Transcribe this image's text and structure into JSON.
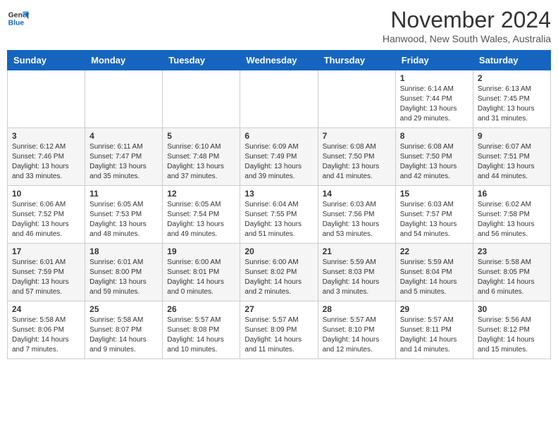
{
  "header": {
    "logo_line1": "General",
    "logo_line2": "Blue",
    "month_title": "November 2024",
    "location": "Hanwood, New South Wales, Australia"
  },
  "weekdays": [
    "Sunday",
    "Monday",
    "Tuesday",
    "Wednesday",
    "Thursday",
    "Friday",
    "Saturday"
  ],
  "weeks": [
    [
      {
        "day": "",
        "text": ""
      },
      {
        "day": "",
        "text": ""
      },
      {
        "day": "",
        "text": ""
      },
      {
        "day": "",
        "text": ""
      },
      {
        "day": "",
        "text": ""
      },
      {
        "day": "1",
        "text": "Sunrise: 6:14 AM\nSunset: 7:44 PM\nDaylight: 13 hours\nand 29 minutes."
      },
      {
        "day": "2",
        "text": "Sunrise: 6:13 AM\nSunset: 7:45 PM\nDaylight: 13 hours\nand 31 minutes."
      }
    ],
    [
      {
        "day": "3",
        "text": "Sunrise: 6:12 AM\nSunset: 7:46 PM\nDaylight: 13 hours\nand 33 minutes."
      },
      {
        "day": "4",
        "text": "Sunrise: 6:11 AM\nSunset: 7:47 PM\nDaylight: 13 hours\nand 35 minutes."
      },
      {
        "day": "5",
        "text": "Sunrise: 6:10 AM\nSunset: 7:48 PM\nDaylight: 13 hours\nand 37 minutes."
      },
      {
        "day": "6",
        "text": "Sunrise: 6:09 AM\nSunset: 7:49 PM\nDaylight: 13 hours\nand 39 minutes."
      },
      {
        "day": "7",
        "text": "Sunrise: 6:08 AM\nSunset: 7:50 PM\nDaylight: 13 hours\nand 41 minutes."
      },
      {
        "day": "8",
        "text": "Sunrise: 6:08 AM\nSunset: 7:50 PM\nDaylight: 13 hours\nand 42 minutes."
      },
      {
        "day": "9",
        "text": "Sunrise: 6:07 AM\nSunset: 7:51 PM\nDaylight: 13 hours\nand 44 minutes."
      }
    ],
    [
      {
        "day": "10",
        "text": "Sunrise: 6:06 AM\nSunset: 7:52 PM\nDaylight: 13 hours\nand 46 minutes."
      },
      {
        "day": "11",
        "text": "Sunrise: 6:05 AM\nSunset: 7:53 PM\nDaylight: 13 hours\nand 48 minutes."
      },
      {
        "day": "12",
        "text": "Sunrise: 6:05 AM\nSunset: 7:54 PM\nDaylight: 13 hours\nand 49 minutes."
      },
      {
        "day": "13",
        "text": "Sunrise: 6:04 AM\nSunset: 7:55 PM\nDaylight: 13 hours\nand 51 minutes."
      },
      {
        "day": "14",
        "text": "Sunrise: 6:03 AM\nSunset: 7:56 PM\nDaylight: 13 hours\nand 53 minutes."
      },
      {
        "day": "15",
        "text": "Sunrise: 6:03 AM\nSunset: 7:57 PM\nDaylight: 13 hours\nand 54 minutes."
      },
      {
        "day": "16",
        "text": "Sunrise: 6:02 AM\nSunset: 7:58 PM\nDaylight: 13 hours\nand 56 minutes."
      }
    ],
    [
      {
        "day": "17",
        "text": "Sunrise: 6:01 AM\nSunset: 7:59 PM\nDaylight: 13 hours\nand 57 minutes."
      },
      {
        "day": "18",
        "text": "Sunrise: 6:01 AM\nSunset: 8:00 PM\nDaylight: 13 hours\nand 59 minutes."
      },
      {
        "day": "19",
        "text": "Sunrise: 6:00 AM\nSunset: 8:01 PM\nDaylight: 14 hours\nand 0 minutes."
      },
      {
        "day": "20",
        "text": "Sunrise: 6:00 AM\nSunset: 8:02 PM\nDaylight: 14 hours\nand 2 minutes."
      },
      {
        "day": "21",
        "text": "Sunrise: 5:59 AM\nSunset: 8:03 PM\nDaylight: 14 hours\nand 3 minutes."
      },
      {
        "day": "22",
        "text": "Sunrise: 5:59 AM\nSunset: 8:04 PM\nDaylight: 14 hours\nand 5 minutes."
      },
      {
        "day": "23",
        "text": "Sunrise: 5:58 AM\nSunset: 8:05 PM\nDaylight: 14 hours\nand 6 minutes."
      }
    ],
    [
      {
        "day": "24",
        "text": "Sunrise: 5:58 AM\nSunset: 8:06 PM\nDaylight: 14 hours\nand 7 minutes."
      },
      {
        "day": "25",
        "text": "Sunrise: 5:58 AM\nSunset: 8:07 PM\nDaylight: 14 hours\nand 9 minutes."
      },
      {
        "day": "26",
        "text": "Sunrise: 5:57 AM\nSunset: 8:08 PM\nDaylight: 14 hours\nand 10 minutes."
      },
      {
        "day": "27",
        "text": "Sunrise: 5:57 AM\nSunset: 8:09 PM\nDaylight: 14 hours\nand 11 minutes."
      },
      {
        "day": "28",
        "text": "Sunrise: 5:57 AM\nSunset: 8:10 PM\nDaylight: 14 hours\nand 12 minutes."
      },
      {
        "day": "29",
        "text": "Sunrise: 5:57 AM\nSunset: 8:11 PM\nDaylight: 14 hours\nand 14 minutes."
      },
      {
        "day": "30",
        "text": "Sunrise: 5:56 AM\nSunset: 8:12 PM\nDaylight: 14 hours\nand 15 minutes."
      }
    ]
  ]
}
